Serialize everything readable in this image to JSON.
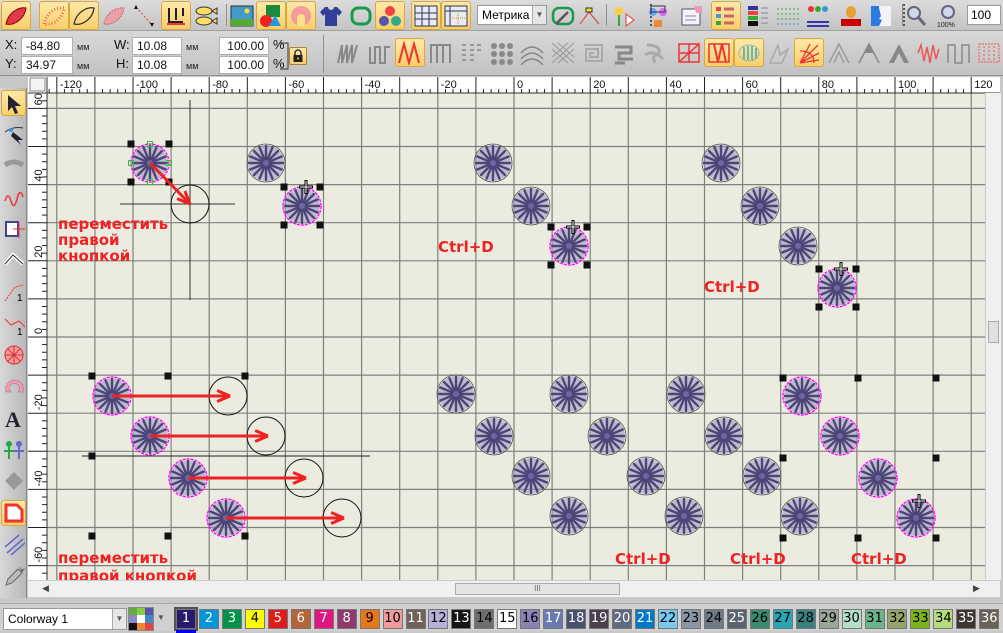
{
  "toolbar1": {
    "buttons": [
      {
        "icon": "satin-leaf-icon",
        "active": true
      },
      {
        "icon": "fill-leaf-icon",
        "active": true
      },
      {
        "icon": "outline-leaf-icon",
        "active": true
      },
      {
        "icon": "faded-leaf-icon",
        "active": false
      },
      {
        "icon": "dotted-path-icon",
        "active": false
      },
      {
        "icon": "fork-icon",
        "active": true
      },
      {
        "icon": "fish-icon",
        "active": false
      },
      {
        "icon": "picture-icon",
        "active": false
      },
      {
        "icon": "shapes-icon",
        "active": true
      },
      {
        "icon": "pink-blob-icon",
        "active": true
      },
      {
        "icon": "shirt-icon",
        "active": false
      },
      {
        "icon": "hoop-icon",
        "active": false
      },
      {
        "icon": "color-balls-icon",
        "active": true
      },
      {
        "icon": "grid-icon",
        "active": true
      },
      {
        "icon": "grid-guides-icon",
        "active": true
      }
    ],
    "units_select": "Метрика",
    "buttons_b": [
      {
        "icon": "hoop-wand-icon",
        "active": false
      },
      {
        "icon": "path-points-icon",
        "active": false
      },
      {
        "icon": "flower-play-icon",
        "active": false
      },
      {
        "icon": "plant-icon",
        "active": false
      },
      {
        "icon": "card-hand-icon",
        "active": false
      },
      {
        "icon": "color-list-icon",
        "active": true
      },
      {
        "icon": "color-bars-icon",
        "active": false
      },
      {
        "icon": "dot-grid-icon",
        "active": false
      },
      {
        "icon": "people-icon",
        "active": false
      },
      {
        "icon": "stamp-icon",
        "active": false
      },
      {
        "icon": "face-icon",
        "active": false
      },
      {
        "icon": "zoom-icon",
        "active": false
      },
      {
        "icon": "zoom-100-icon",
        "active": false
      }
    ],
    "zoom_value": "100"
  },
  "props": {
    "x_label": "X:",
    "x_value": "-84.80",
    "y_label": "Y:",
    "y_value": "34.97",
    "w_label": "W:",
    "w_value": "10.08",
    "h_label": "H:",
    "h_value": "10.08",
    "unit": "мм",
    "scale_x": "100.00",
    "scale_y": "100.00",
    "percent": "%"
  },
  "toolbar2": {
    "stitch_buttons": [
      {
        "icon": "zigzag-stitch-icon",
        "active": false
      },
      {
        "icon": "wave-stitch-icon",
        "active": false
      },
      {
        "icon": "red-zigzag-stitch-icon",
        "active": true
      },
      {
        "icon": "square-stitch-icon",
        "active": false
      },
      {
        "icon": "hatch-stitch-icon",
        "active": false
      },
      {
        "icon": "dots-stitch-icon",
        "active": false
      },
      {
        "icon": "arc-stitch-icon",
        "active": false
      },
      {
        "icon": "cross-stitch-icon",
        "active": false
      },
      {
        "icon": "maze-stitch-icon",
        "active": false
      },
      {
        "icon": "spiral-stitch-icon",
        "active": false
      },
      {
        "icon": "motif-stitch-icon",
        "active": false
      }
    ],
    "effect_buttons": [
      {
        "icon": "red-grid-icon",
        "active": false
      },
      {
        "icon": "red-zig-fill-icon",
        "active": true
      },
      {
        "icon": "blue-fill-icon",
        "active": true
      },
      {
        "icon": "star-icon",
        "active": false
      },
      {
        "icon": "fan-icon",
        "active": true
      },
      {
        "icon": "peak-outline-icon",
        "active": false
      },
      {
        "icon": "peak-icon",
        "active": false
      },
      {
        "icon": "peak-solid-icon",
        "active": false
      },
      {
        "icon": "red-wave-icon",
        "active": false
      },
      {
        "icon": "square-wave-icon",
        "active": false
      },
      {
        "icon": "red-dots-icon",
        "active": false
      }
    ]
  },
  "left_tools": [
    {
      "icon": "select-arrow-icon",
      "active": true
    },
    {
      "icon": "reshape-icon",
      "active": false
    },
    {
      "icon": "arc-tool-icon",
      "active": false
    },
    {
      "icon": "freehand-icon",
      "active": false
    },
    {
      "icon": "applique-icon",
      "active": false
    },
    {
      "icon": "polyline-icon",
      "active": false
    },
    {
      "icon": "running-1-icon",
      "active": false
    },
    {
      "icon": "running-2-icon",
      "active": false
    },
    {
      "icon": "star-fill-icon",
      "active": false
    },
    {
      "icon": "crescent-icon",
      "active": false
    },
    {
      "icon": "text-icon",
      "active": false
    },
    {
      "icon": "people-tool-icon",
      "active": false
    },
    {
      "icon": "monogram-icon",
      "active": false
    },
    {
      "icon": "border-icon",
      "active": true
    },
    {
      "icon": "parallel-lines-icon",
      "active": false
    },
    {
      "icon": "pencil-icon",
      "active": false
    }
  ],
  "rulers": {
    "x_labels": [
      "-120",
      "-100",
      "-80",
      "-60",
      "-40",
      "-20",
      "0",
      "20",
      "40",
      "60",
      "80",
      "100",
      "120"
    ],
    "y_labels": [
      "60",
      "40",
      "20",
      "0",
      "-20",
      "-40",
      "-60"
    ]
  },
  "annotations": {
    "move_right_1": [
      "переместить",
      "правой",
      "кнопкой"
    ],
    "move_right_2": [
      "переместить",
      "правой кнопкой"
    ],
    "ctrl_d": "Ctrl+D"
  },
  "colors": {
    "accent_red": "#ee2222",
    "canvas": "#ecebdf",
    "grid": "#7f7f7f",
    "flower": "#6e66a0",
    "selection": "#ff00ff"
  },
  "palette": {
    "colorway": "Colorway 1",
    "current": "1",
    "swatches": [
      {
        "n": "1",
        "c": "#2a1a6e",
        "t": "#fff"
      },
      {
        "n": "2",
        "c": "#0096dc",
        "t": "#fff"
      },
      {
        "n": "3",
        "c": "#00914a",
        "t": "#fff"
      },
      {
        "n": "4",
        "c": "#ffff00",
        "t": "#000"
      },
      {
        "n": "5",
        "c": "#e01b1b",
        "t": "#fff"
      },
      {
        "n": "6",
        "c": "#b5653a",
        "t": "#fff"
      },
      {
        "n": "7",
        "c": "#e0157f",
        "t": "#fff"
      },
      {
        "n": "8",
        "c": "#8e3a6e",
        "t": "#fff"
      },
      {
        "n": "9",
        "c": "#e67817",
        "t": "#000"
      },
      {
        "n": "10",
        "c": "#f09a9a",
        "t": "#000"
      },
      {
        "n": "11",
        "c": "#6e625a",
        "t": "#fff"
      },
      {
        "n": "12",
        "c": "#b8b0d8",
        "t": "#000"
      },
      {
        "n": "13",
        "c": "#151515",
        "t": "#fff"
      },
      {
        "n": "14",
        "c": "#6e6e6e",
        "t": "#000"
      },
      {
        "n": "15",
        "c": "#ffffff",
        "t": "#000"
      },
      {
        "n": "16",
        "c": "#8a82b4",
        "t": "#000"
      },
      {
        "n": "17",
        "c": "#6a7ab0",
        "t": "#fff"
      },
      {
        "n": "18",
        "c": "#4a5070",
        "t": "#fff"
      },
      {
        "n": "19",
        "c": "#4a4050",
        "t": "#fff"
      },
      {
        "n": "20",
        "c": "#606a80",
        "t": "#fff"
      },
      {
        "n": "21",
        "c": "#0078c8",
        "t": "#fff"
      },
      {
        "n": "22",
        "c": "#78c8f0",
        "t": "#000"
      },
      {
        "n": "23",
        "c": "#8a96a6",
        "t": "#000"
      },
      {
        "n": "24",
        "c": "#6e7a86",
        "t": "#000"
      },
      {
        "n": "25",
        "c": "#5a6470",
        "t": "#fff"
      },
      {
        "n": "26",
        "c": "#3a8a70",
        "t": "#000"
      },
      {
        "n": "27",
        "c": "#28a6b4",
        "t": "#000"
      },
      {
        "n": "28",
        "c": "#3a8080",
        "t": "#000"
      },
      {
        "n": "29",
        "c": "#9aa696",
        "t": "#000"
      },
      {
        "n": "30",
        "c": "#b4e0c8",
        "t": "#000"
      },
      {
        "n": "31",
        "c": "#6ab48a",
        "t": "#000"
      },
      {
        "n": "32",
        "c": "#96a46a",
        "t": "#000"
      },
      {
        "n": "33",
        "c": "#7ab41a",
        "t": "#000"
      },
      {
        "n": "34",
        "c": "#b4dc78",
        "t": "#000"
      },
      {
        "n": "35",
        "c": "#3e3632",
        "t": "#fff"
      },
      {
        "n": "36",
        "c": "#6a6258",
        "t": "#fff"
      }
    ]
  }
}
